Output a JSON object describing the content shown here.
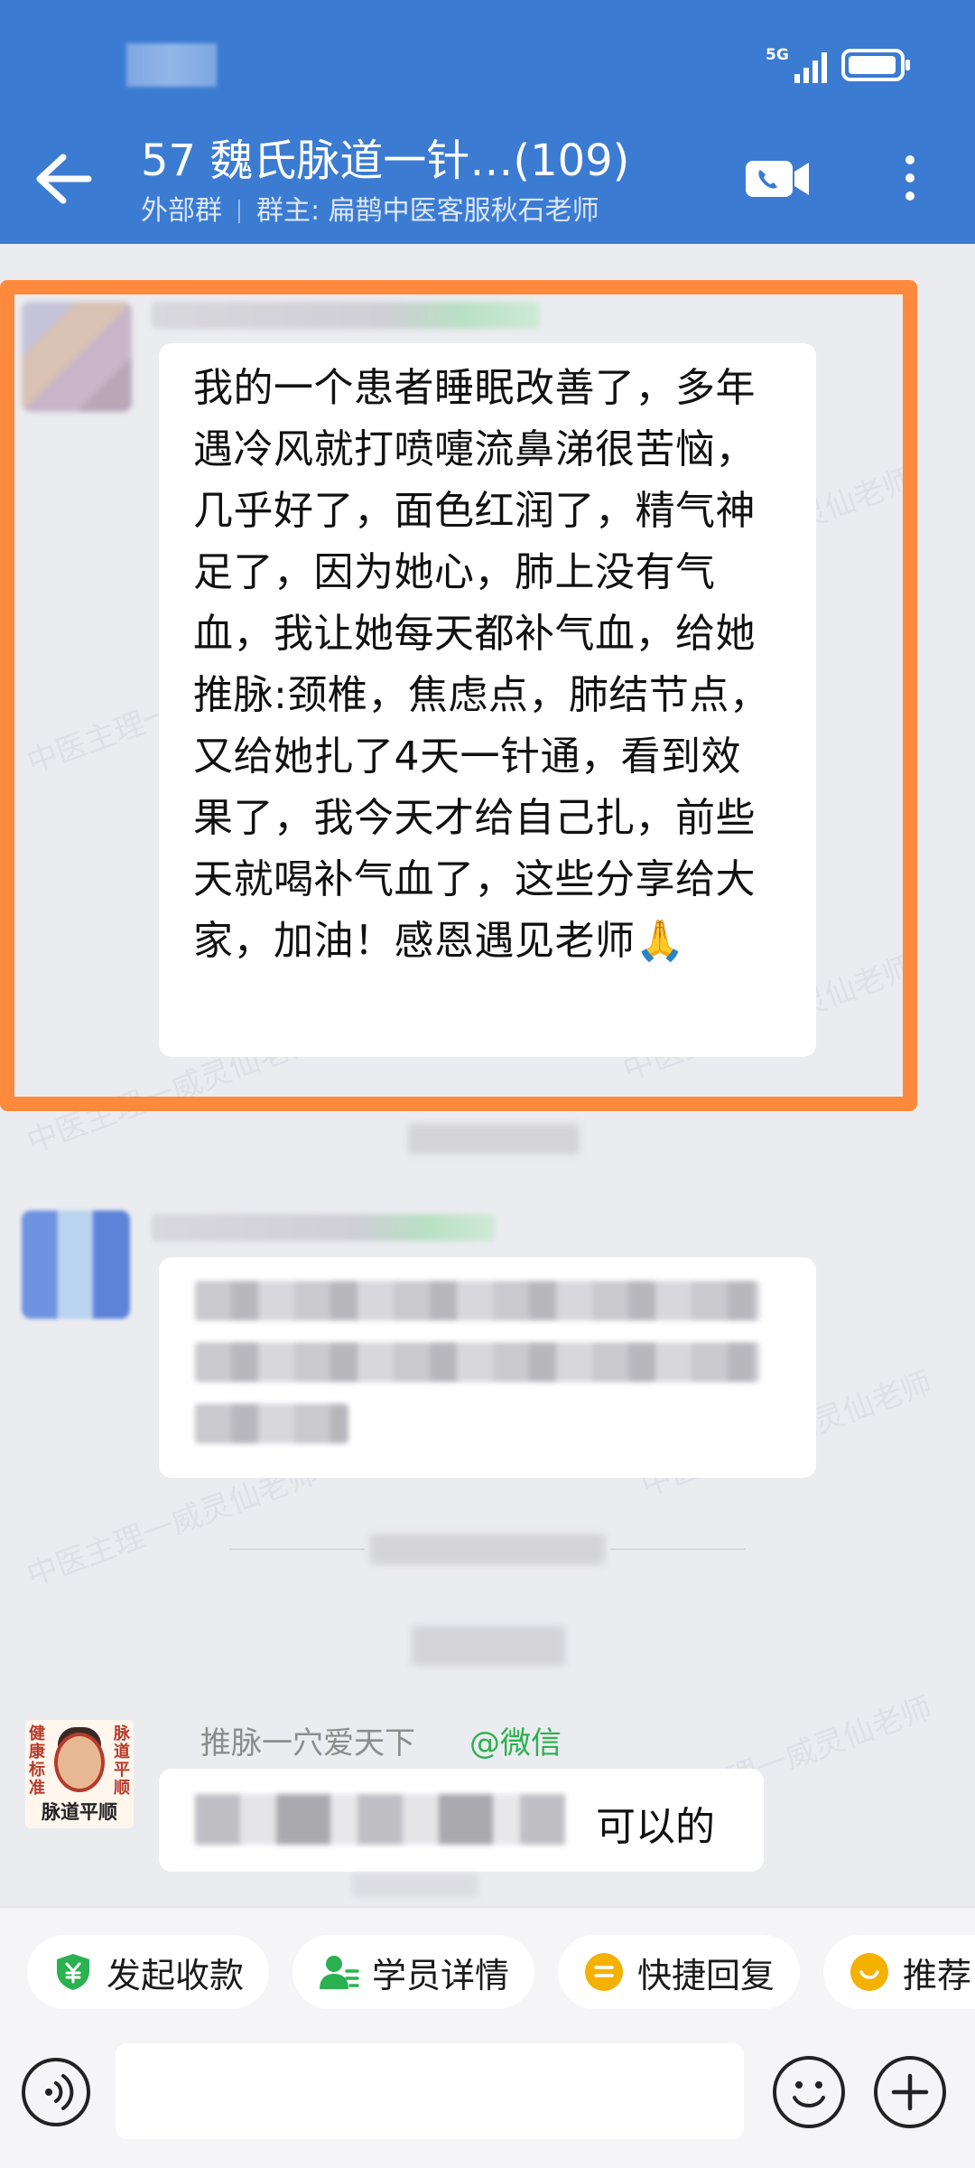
{
  "status_bar": {
    "network": "5G"
  },
  "header": {
    "title": "57   魏氏脉道一针…(109)",
    "tag": "外部群",
    "owner": "群主: 扁鹊中医客服秋石老师"
  },
  "watermark": "中医主理一威灵仙老师",
  "messages": {
    "highlighted": {
      "text": "我的一个患者睡眠改善了，多年遇冷风就打喷嚏流鼻涕很苦恼，几乎好了，面色红润了，精气神足了，因为她心，肺上没有气血，我让她每天都补气血，给她推脉:颈椎，焦虑点，肺结节点，又给她扎了4天一针通，看到效果了，我今天才给自己扎，前些天就喝补气血了，这些分享给大家，加油！感恩遇见老师🙏"
    },
    "last": {
      "sender": "推脉一穴爱天下",
      "source": "@微信",
      "text": "可以的",
      "avatar": {
        "left": "脉道平顺",
        "right": "健康标准",
        "bottom": "脉道平顺"
      }
    }
  },
  "quick_actions": [
    {
      "label": "发起收款",
      "icon": "payment-icon",
      "color": "#2bb14f"
    },
    {
      "label": "学员详情",
      "icon": "user-detail-icon",
      "color": "#2bb14f"
    },
    {
      "label": "快捷回复",
      "icon": "quick-reply-icon",
      "color": "#f5b100"
    },
    {
      "label": "推荐",
      "icon": "recommend-icon",
      "color": "#f5b100"
    }
  ],
  "colors": {
    "header": "#3c7bd2",
    "highlight": "#ff8a3d",
    "background": "#ebecf0"
  }
}
